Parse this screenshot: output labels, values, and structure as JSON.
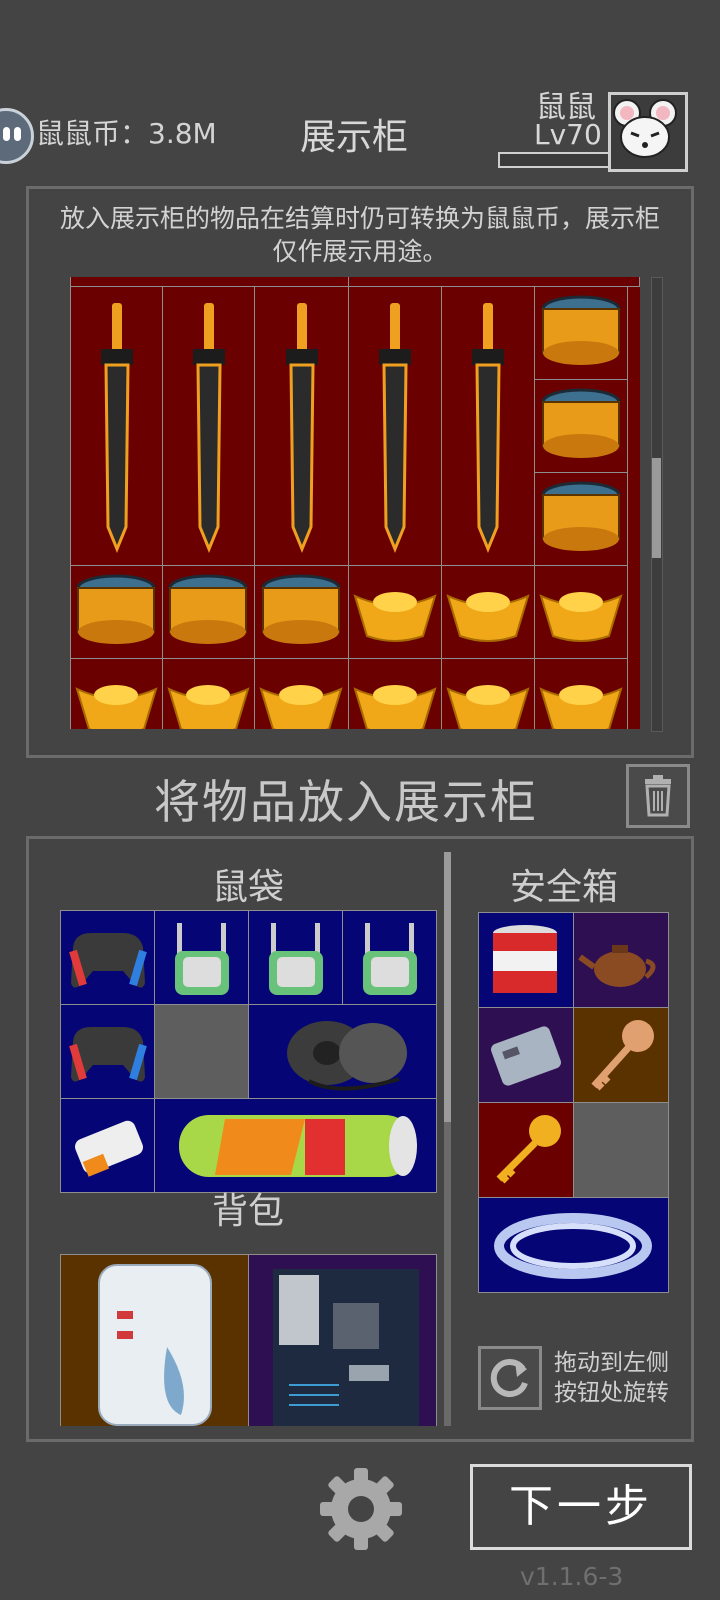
{
  "header": {
    "coins_label": "鼠鼠币：3.8M",
    "title": "展示柜",
    "player_name": "鼠鼠",
    "player_level": "Lv70"
  },
  "showcase": {
    "note": "放入展示柜的物品在结算时仍可转换为鼠鼠币，展示柜仅作展示用途。",
    "items": [
      "sword",
      "sword",
      "sword",
      "sword",
      "sword",
      "gold-drum",
      "gold-drum",
      "gold-drum",
      "gold-drum",
      "gold-drum",
      "gold-drum",
      "gold-ingot",
      "gold-ingot",
      "gold-ingot",
      "gold-ingot",
      "gold-ingot",
      "gold-ingot",
      "gold-ingot",
      "gold-ingot",
      "gold-ingot"
    ]
  },
  "place_heading": "将物品放入展示柜",
  "inventory": {
    "pouch_label": "鼠袋",
    "pouch_items": [
      "gamepad",
      "wifi-router",
      "wifi-router",
      "wifi-router",
      "gamepad",
      "empty",
      "speaker",
      "power-bank",
      "tube-snack"
    ],
    "backpack_label": "背包",
    "backpack_items": [
      "milk-powder-jug",
      "motherboard"
    ],
    "safe_label": "安全箱",
    "safe_items": [
      "canned-food",
      "teapot",
      "battery-pack",
      "brass-key",
      "gold-key",
      "empty",
      "cable-coil"
    ],
    "rotate_hint_line1": "拖动到左侧",
    "rotate_hint_line2": "按钮处旋转"
  },
  "footer": {
    "next_label": "下一步",
    "version": "v1.1.6-3"
  },
  "colors": {
    "background": "#444444",
    "showcase_cell": "#6b0000",
    "pouch_cell": "#050575"
  }
}
